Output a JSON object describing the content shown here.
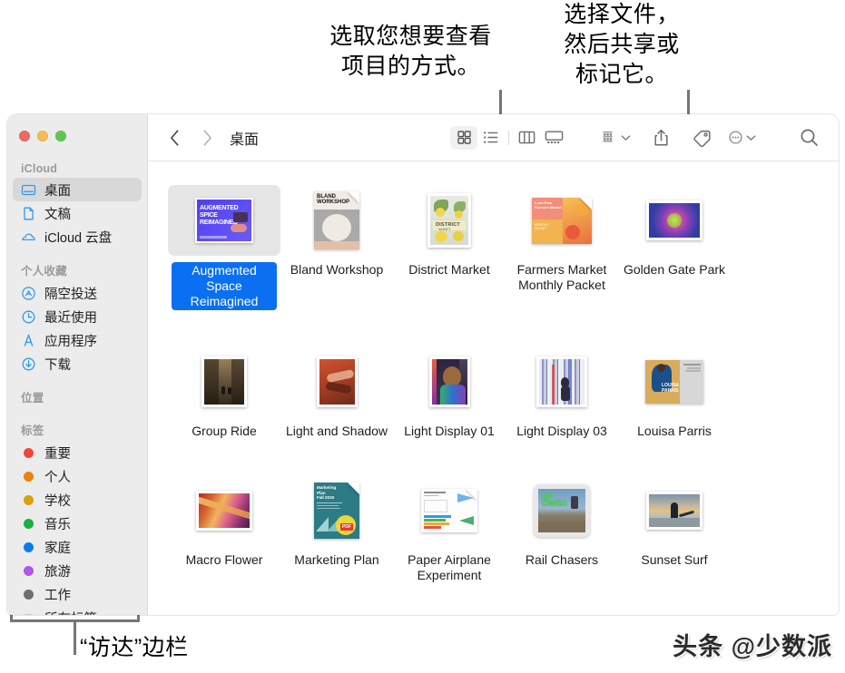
{
  "annotations": {
    "view_modes": "选取您想要查看\n项目的方式。",
    "share_tag": "选择文件，\n然后共享或\n标记它。",
    "sidebar": "“访达”边栏"
  },
  "watermark": "头条 @少数派",
  "window": {
    "traffic_lights": [
      "close",
      "minimize",
      "zoom"
    ],
    "colors": {
      "close": "#ed6a5e",
      "minimize": "#f5bd4f",
      "zoom": "#61c554",
      "selection_blue": "#0a6ff1",
      "sidebar_bg": "#ececec",
      "sidebar_selected": "#d8d8d8",
      "icon_gray": "#6f6f6f",
      "accent_blue": "#2f98f0"
    }
  },
  "sidebar": {
    "sections": [
      {
        "header": "iCloud",
        "items": [
          {
            "label": "桌面",
            "icon": "desktop-icon",
            "selected": true
          },
          {
            "label": "文稿",
            "icon": "document-icon",
            "selected": false
          },
          {
            "label": "iCloud 云盘",
            "icon": "cloud-icon",
            "selected": false
          }
        ]
      },
      {
        "header": "个人收藏",
        "items": [
          {
            "label": "隔空投送",
            "icon": "airdrop-icon",
            "selected": false
          },
          {
            "label": "最近使用",
            "icon": "clock-icon",
            "selected": false
          },
          {
            "label": "应用程序",
            "icon": "applications-icon",
            "selected": false
          },
          {
            "label": "下载",
            "icon": "downloads-icon",
            "selected": false
          }
        ]
      },
      {
        "header": "位置",
        "items": []
      },
      {
        "header": "标签",
        "items": [
          {
            "label": "重要",
            "icon": "tag-dot-red",
            "color": "#f4453c"
          },
          {
            "label": "个人",
            "icon": "tag-dot-orange",
            "color": "#e8830c"
          },
          {
            "label": "学校",
            "icon": "tag-dot-yellow",
            "color": "#dba00a"
          },
          {
            "label": "音乐",
            "icon": "tag-dot-green",
            "color": "#19b13c"
          },
          {
            "label": "家庭",
            "icon": "tag-dot-blue",
            "color": "#0a7cf1"
          },
          {
            "label": "旅游",
            "icon": "tag-dot-purple",
            "color": "#b255e8"
          },
          {
            "label": "工作",
            "icon": "tag-dot-gray",
            "color": "#6e6e6e"
          },
          {
            "label": "所有标签...",
            "icon": "all-tags-icon",
            "color": "#8a8a8a"
          }
        ]
      }
    ]
  },
  "toolbar": {
    "back_label": "后退",
    "forward_label": "前进",
    "folder_title": "桌面",
    "view_modes": [
      {
        "name": "icon-view",
        "label": "图标显示",
        "active": true
      },
      {
        "name": "list-view",
        "label": "列表显示",
        "active": false
      },
      {
        "name": "column-view",
        "label": "分栏显示",
        "active": false
      },
      {
        "name": "gallery-view",
        "label": "画廊显示",
        "active": false
      }
    ],
    "group_label": "排列方式",
    "share_label": "共享",
    "tag_label": "标记",
    "more_label": "更多操作",
    "search_label": "搜索"
  },
  "files": [
    {
      "name": "Augmented Space Reimagined",
      "kind": "keynote-poster",
      "selected": true
    },
    {
      "name": "Bland Workshop",
      "kind": "pages-doc",
      "selected": false
    },
    {
      "name": "District Market",
      "kind": "photo-lemons",
      "selected": false
    },
    {
      "name": "Farmers Market Monthly Packet",
      "kind": "pages-doc-fruit",
      "selected": false
    },
    {
      "name": "Golden Gate Park",
      "kind": "photo-flower",
      "selected": false
    },
    {
      "name": "Group Ride",
      "kind": "photo-road",
      "selected": false
    },
    {
      "name": "Light and Shadow",
      "kind": "photo-hands",
      "selected": false
    },
    {
      "name": "Light Display 01",
      "kind": "photo-portrait",
      "selected": false
    },
    {
      "name": "Light Display 03",
      "kind": "photo-stripes",
      "selected": false
    },
    {
      "name": "Louisa Parris",
      "kind": "doc-louisa",
      "selected": false
    },
    {
      "name": "Macro Flower",
      "kind": "photo-macro",
      "selected": false
    },
    {
      "name": "Marketing Plan",
      "kind": "pdf-marketing",
      "selected": false
    },
    {
      "name": "Paper Airplane Experiment",
      "kind": "numbers-doc",
      "selected": false
    },
    {
      "name": "Rail Chasers",
      "kind": "photo-rail",
      "selected": false
    },
    {
      "name": "Sunset Surf",
      "kind": "photo-surf",
      "selected": false
    }
  ]
}
